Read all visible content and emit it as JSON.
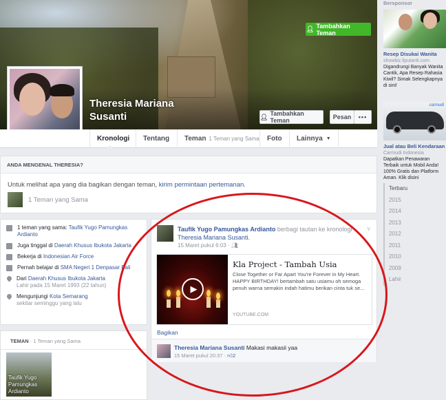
{
  "profile": {
    "name_line1": "Theresia Mariana",
    "name_line2": "Susanti"
  },
  "cover_actions": {
    "add_friend": "Tambahkan Teman",
    "message": "Pesan",
    "more": "•••"
  },
  "nav": {
    "timeline": "Kronologi",
    "about": "Tentang",
    "friends": "Teman",
    "friends_sub": "1 Teman yang Sama",
    "photos": "Foto",
    "more": "Lainnya"
  },
  "know_box": {
    "heading": "ANDA MENGENAL THERESIA?",
    "text": "Untuk melihat apa yang dia bagikan dengan teman,",
    "link": "kirim permintaan pertemanan.",
    "button": "Tambahkan Teman",
    "mutual": "1 Teman yang Sama"
  },
  "intro": {
    "mutual_prefix": "1 teman yang sama:",
    "mutual_name": "Taufik Yugo Pamungkas Ardianto",
    "lives_prefix": "Juga tinggal di",
    "lives_place": "Daerah Khusus Ibukota Jakarta",
    "work_prefix": "Bekerja di",
    "work_place": "Indonesian Air Force",
    "study_prefix": "Pernah belajar di",
    "study_place": "SMA Negeri 1 Denpasar Bali",
    "from_prefix": "Dari",
    "from_place": "Daerah Khusus Ibukota Jakarta",
    "birth": "Lahir pada 15 Maret 1993 (22 tahun)",
    "visit_prefix": "Mengunjungi",
    "visit_place": "Kota Semarang",
    "visit_when": "sekitar seminggu yang lalu"
  },
  "friends_card": {
    "heading": "TEMAN",
    "sub": "· 1 Teman yang Sama",
    "friend_name": "Taufik Yugo Pamungkas Ardianto"
  },
  "post": {
    "author": "Taufik Yugo Pamungkas Ardianto",
    "action": "berbagi tautan ke kronologi",
    "target": "Theresia Mariana Susanti.",
    "time": "15 Maret pukul 6:03 · ",
    "link_title": "Kla Project - Tambah Usia",
    "link_desc": "Close Together or Far Apart You're Forever in My Heart. HAPPY BIRTHDAY! bertambah satu usiamu oh semoga penuh warna semakin indah hatimu berikan cinta tuk se...",
    "link_domain": "YOUTUBE.COM",
    "share": "Bagikan",
    "comment_author": "Theresia Mariana Susanti",
    "comment_text": "Makasi makasii yaa",
    "comment_time": "15 Maret pukul 20:37 · ",
    "comment_likes": "2"
  },
  "sponsored": {
    "label": "Bersponsor",
    "ad1_title": "Resep Disukai Wanita",
    "ad1_source": "showbiz.liputan6.com",
    "ad1_body": "Digandrungi Banyak Wanita Cantik, Apa Resep Rahasia Kiwil? Simak Selengkapnya di sini!",
    "ad2_brand": "carmudi",
    "ad2_title": "Jual atau Beli Kendaraan",
    "ad2_source": "Carmudi Indonesia",
    "ad2_body": "Dapatkan Penawaran Terbaik untuk Mobil Anda! 100% Gratis dan Platform Aman. Klik disini"
  },
  "timeline_years": [
    "Terbaru",
    "2015",
    "2014",
    "2013",
    "2012",
    "2011",
    "2010",
    "2009",
    "Lahir"
  ],
  "colors": {
    "link": "#365899",
    "green_button": "#42b72a",
    "annotation": "#d8161b"
  }
}
